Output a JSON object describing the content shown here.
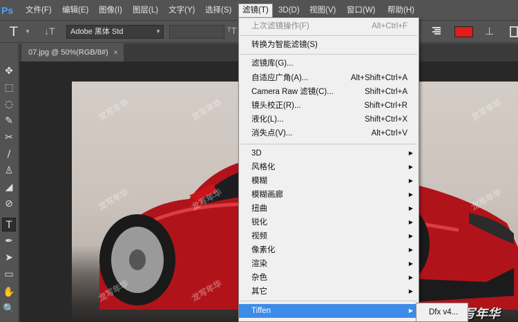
{
  "app": {
    "logo": "Ps"
  },
  "menubar": {
    "items": [
      {
        "label": "文件(F)"
      },
      {
        "label": "编辑(E)"
      },
      {
        "label": "图像(I)"
      },
      {
        "label": "图层(L)"
      },
      {
        "label": "文字(Y)"
      },
      {
        "label": "选择(S)"
      },
      {
        "label": "滤镜(T)",
        "active": true
      },
      {
        "label": "3D(D)"
      },
      {
        "label": "视图(V)"
      },
      {
        "label": "窗口(W)"
      },
      {
        "label": "帮助(H)"
      }
    ]
  },
  "options": {
    "font_family": "Adobe 黑体 Std",
    "text_color": "#e21b1b",
    "tool_icon": "type-tool-icon"
  },
  "document": {
    "tab_title": "07.jpg @ 50%(RGB/8#)",
    "close_glyph": "×"
  },
  "filter_menu": {
    "last_filter": {
      "label": "上次滤镜操作(F)",
      "shortcut": "Alt+Ctrl+F",
      "disabled": true
    },
    "convert_smart": {
      "label": "转换为智能滤镜(S)"
    },
    "group1": [
      {
        "label": "滤镜库(G)...",
        "shortcut": ""
      },
      {
        "label": "自适应广角(A)...",
        "shortcut": "Alt+Shift+Ctrl+A"
      },
      {
        "label": "Camera Raw 滤镜(C)...",
        "shortcut": "Shift+Ctrl+A"
      },
      {
        "label": "镜头校正(R)...",
        "shortcut": "Shift+Ctrl+R"
      },
      {
        "label": "液化(L)...",
        "shortcut": "Shift+Ctrl+X"
      },
      {
        "label": "消失点(V)...",
        "shortcut": "Alt+Ctrl+V"
      }
    ],
    "group2": [
      {
        "label": "3D"
      },
      {
        "label": "风格化"
      },
      {
        "label": "模糊"
      },
      {
        "label": "模糊画廊"
      },
      {
        "label": "扭曲"
      },
      {
        "label": "锐化"
      },
      {
        "label": "视频"
      },
      {
        "label": "像素化"
      },
      {
        "label": "渲染"
      },
      {
        "label": "杂色"
      },
      {
        "label": "其它"
      }
    ],
    "tiffen": {
      "label": "Tiffen",
      "highlighted": true
    }
  },
  "submenu": {
    "item": "Dfx v4..."
  },
  "watermark": {
    "text": "龙写年华"
  }
}
